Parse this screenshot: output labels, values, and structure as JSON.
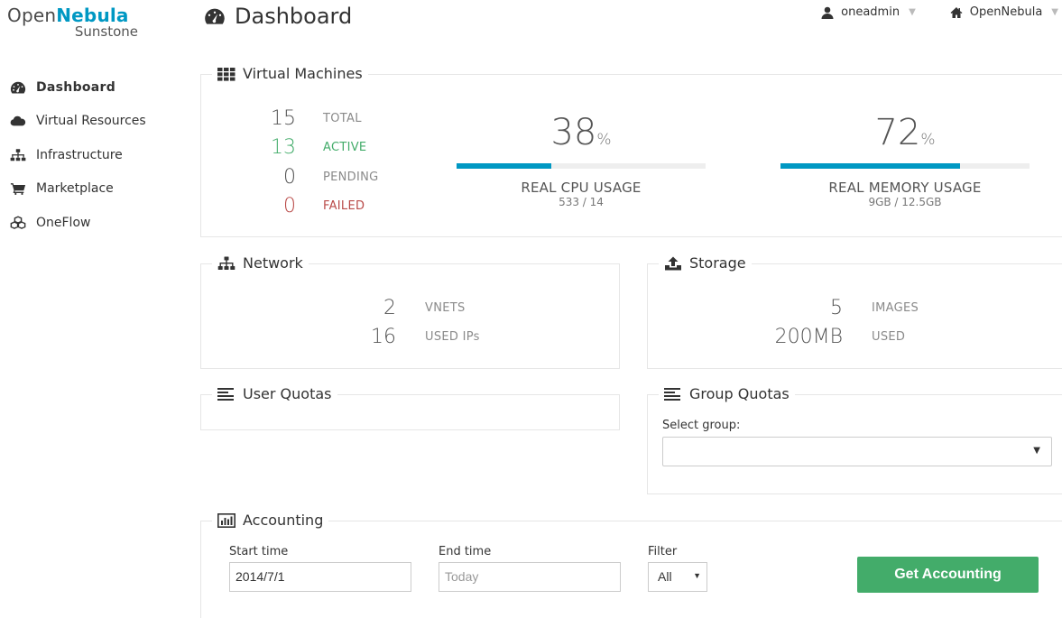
{
  "logo": {
    "part1": "Open",
    "part2": "Nebula",
    "sub": "Sunstone"
  },
  "sidebar": {
    "items": [
      {
        "label": "Dashboard",
        "icon": "dashboard-icon"
      },
      {
        "label": "Virtual Resources",
        "icon": "cloud-icon"
      },
      {
        "label": "Infrastructure",
        "icon": "sitemap-icon"
      },
      {
        "label": "Marketplace",
        "icon": "shopping-cart-icon"
      },
      {
        "label": "OneFlow",
        "icon": "cubes-icon"
      }
    ]
  },
  "header": {
    "title": "Dashboard",
    "user": "oneadmin",
    "zone": "OpenNebula"
  },
  "vms": {
    "title": "Virtual Machines",
    "total": {
      "value": "15",
      "label": "TOTAL"
    },
    "active": {
      "value": "13",
      "label": "ACTIVE"
    },
    "pending": {
      "value": "0",
      "label": "PENDING"
    },
    "failed": {
      "value": "0",
      "label": "FAILED"
    },
    "cpu": {
      "value": "38",
      "unit": "%",
      "label": "REAL CPU USAGE",
      "detail": "533 / 14",
      "fraction": 0.38
    },
    "memory": {
      "value": "72",
      "unit": "%",
      "label": "REAL MEMORY USAGE",
      "detail": "9GB / 12.5GB",
      "fraction": 0.72
    }
  },
  "network": {
    "title": "Network",
    "vnets": {
      "value": "2",
      "label": "VNETS"
    },
    "ips": {
      "value": "16",
      "label": "USED IPs"
    }
  },
  "storage": {
    "title": "Storage",
    "images": {
      "value": "5",
      "label": "IMAGES"
    },
    "used": {
      "value": "200MB",
      "label": "USED"
    }
  },
  "user_quotas": {
    "title": "User Quotas"
  },
  "group_quotas": {
    "title": "Group Quotas",
    "select_label": "Select group:",
    "selected": ""
  },
  "accounting": {
    "title": "Accounting",
    "start_label": "Start time",
    "start_value": "2014/7/1",
    "end_label": "End time",
    "end_placeholder": "Today",
    "filter_label": "Filter",
    "filter_value": "All",
    "button": "Get Accounting"
  },
  "colors": {
    "accent": "#0098c3",
    "active": "#43ac6a",
    "failed": "#b94a48",
    "button": "#43ac6a"
  }
}
